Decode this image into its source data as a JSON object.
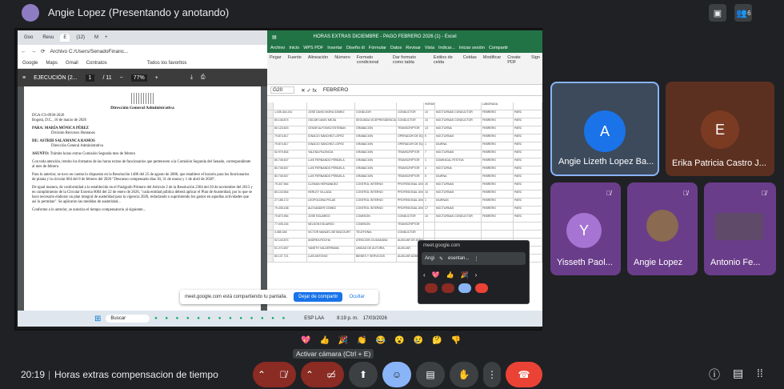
{
  "header": {
    "presenter_name": "Angie Lopez (Presentando y anotando)",
    "presenter_initial": "",
    "people_count": "6"
  },
  "browser": {
    "tabs": [
      "Goo",
      "Resu",
      "E",
      "(12)",
      "M"
    ],
    "address": "Archivo   C:/Users/SenadoFinanc...",
    "bookmarks": [
      "Google",
      "Maps",
      "Gmail",
      "Contratos",
      "Todos los favoritos"
    ],
    "pdf_title": "EJECUCIÓN (2...",
    "pdf_page": "1",
    "pdf_pages": "/ 11",
    "pdf_zoom": "77%",
    "doc": {
      "org": "Dirección General Administrativa",
      "ref": "DGA-CS-0930-2026",
      "date": "Bogotá, D.C., 16 de marzo de 2026",
      "para_label": "PARA:",
      "para_name": "MARÍA MÓNICA PÉREZ",
      "para_role": "División Recursos Humanos",
      "de_label": "DE:",
      "de_name": "ASTRID SALAMANCA RAMOS",
      "de_role": "Dirección General Administrativa",
      "asunto_label": "ASUNTO:",
      "asunto": "Trámite horas extras Comisión Segunda mes de febrero",
      "p1": "Con toda atención, remito los formatos de las horas extras de funcionarios que pertenecen a la Comisión Segunda del Senado, correspondiente al mes de febrero.",
      "p2": "Para lo anterior, se tuvo en cuenta lo dispuesto en la Resolución 1486 del 25 de agosto de 2006, que establece el horario para los funcionarios de planta y la circular 004 del 8 de febrero del 2026 \"Descanso compensado días 30, 31 de marzo y 1 de abril de 2026\".",
      "p3": "De igual manera, de conformidad a lo establecido en el Parágrafo Primero del Artículo 2 de la Resolución 2304 del 20 de noviembre del 2013 y en cumplimiento de la Circular Externa 0004 del 22 de enero de 2026, \"cada entidad pública deberá aplicar el Plan de Austeridad, por lo que se hace necesario elaborar un plan integral de austeridad para la vigencia 2026, redactando o suprimiendo los gastos en aquellas actividades que así lo permitan\". Se aplicaron las medidas de austeridad...",
      "p4": "Conforme a lo anterior, se autoriza el tiempo compensatorio al siguiente..."
    }
  },
  "excel": {
    "title": "HORAS EXTRAS DICIEMBRE - PAGO FEBRERO 2026 (1) - Excel",
    "menu": [
      "Archivo",
      "Inicio",
      "WPS PDF",
      "Insertar",
      "Diseño di",
      "Fórmular",
      "Datos",
      "Revisar",
      "Vista",
      "Indicar...",
      "Iniciar sesión",
      "Compartir"
    ],
    "ribbon": [
      "Pegar",
      "Fuente",
      "Alineación",
      "Número",
      "Formato condicional",
      "Dar formato como tabla",
      "Estilos de celda",
      "Celdas",
      "Modificar",
      "Create PDF",
      "Sign"
    ],
    "cell_ref": "G20",
    "formula": "FEBRERO",
    "header_row": [
      "",
      "",
      "",
      "",
      "HORAS",
      "",
      "LABORADA",
      ""
    ],
    "rows": [
      [
        "1.035.344.241",
        "JOSÉ DAVID MORA GÓMEZ",
        "CONDUCIR",
        "CONDUCTOR",
        "10",
        "NOCTURNAS CONDUCTOR",
        "FEBRERO",
        "PARC"
      ],
      [
        "80.146.874",
        "OSCAR DAVID MEJÍA",
        "SEGUNDA VICEPRESIDENCIA",
        "CONDUCTOR",
        "10",
        "NOCTURNAS CONDUCTOR",
        "FEBRERO",
        "PARC"
      ],
      [
        "80.123.603",
        "CESAR ALFONSO ESTEBAN",
        "GRABACION",
        "TRANSCRIPTOR",
        "13",
        "NOCTURNA",
        "FEBRERO",
        "PARC"
      ],
      [
        "79.874.817",
        "IGNACIO SÁNCHEZ LÓPEZ",
        "GRABACION",
        "OPERADOR DE EQUIPO",
        "9",
        "NOCTURNAS",
        "FEBRERO",
        "PARC"
      ],
      [
        "79.874.817",
        "IGNACIO SÁNCHEZ LÓPEZ",
        "GRABACION",
        "OPERADOR DE EQUIPO",
        "1",
        "DIURNA",
        "FEBRERO",
        "PARC"
      ],
      [
        "52.979.834",
        "YALENA PALENCIA",
        "GRABACION",
        "TRANSCRIPTOR",
        "7",
        "NOCTURNAS",
        "FEBRERO",
        "PARC"
      ],
      [
        "80.745.547",
        "LUIS FERNANDO PEÑUELA",
        "GRABACION",
        "TRANSCRIPTOR",
        "1",
        "DOMINICAL FESTIVA",
        "FEBRERO",
        "PARC"
      ],
      [
        "80.745.547",
        "LUIS FERNANDO PEÑUELA",
        "GRABACION",
        "TRANSCRIPTOR",
        "4",
        "NOCTURNA",
        "FEBRERO",
        "PARC"
      ],
      [
        "80.745.547",
        "LUIS FERNANDO PEÑUELA",
        "GRABACION",
        "TRANSCRIPTOR",
        "5",
        "DIURNA",
        "FEBRERO",
        "PARC"
      ],
      [
        "79.347.564",
        "CLEMAN HERNANDEZ",
        "CONTROL INTERNO",
        "PROFESIONAL UNIVERSITARIO",
        "20",
        "NOCTURNAS",
        "FEBRERO",
        "PARC"
      ],
      [
        "80.143.564",
        "HERLEY VILLADA",
        "CONTROL INTERNO",
        "PROFESIONAL UNIVERSITARIO",
        "10",
        "NOCTURNAS",
        "FEBRERO",
        "PARC"
      ],
      [
        "27.185.172",
        "LEOPOLDINA PELAE",
        "CONTROL INTERNO",
        "PROFESIONAL UNIVERSITARIO",
        "1",
        "DIURNAS",
        "FEBRERO",
        "PARC"
      ],
      [
        "79.435.438",
        "ALEXANDER GÓMEZ",
        "CONTROL INTERNO",
        "PROFESIONAL UNIVERSITARIO",
        "17",
        "NOCTURNAS",
        "FEBRERO",
        "PARC"
      ],
      [
        "79.873.954",
        "JOSÉ EDUARDO",
        "COMISION",
        "CONDUCTOR",
        "10",
        "NOCTURNAS CONDUCTOR",
        "FEBRERO",
        "PARC"
      ],
      [
        "77.005.154",
        "NELSON EDUARDO",
        "COMISION",
        "TRANSCRIPTOR",
        "",
        "",
        "",
        ""
      ],
      [
        "3.485.345",
        "VICTOR MANUEL BETANCOURT",
        "TELEFONIA",
        "CONDUCTOR",
        "",
        "",
        "",
        ""
      ],
      [
        "52.143.874",
        "ANDREA ROCHA",
        "ATENCION CIUDADANA",
        "AUXILIAR DE ATENCION",
        "",
        "",
        "",
        ""
      ],
      [
        "51.274.657",
        "YANETH VALDERRAMA",
        "UNIDAD DE AUTORIA",
        "AUXILIAR",
        "",
        "",
        "",
        ""
      ],
      [
        "80.137.721",
        "LUIS ANTONIO",
        "BIENES Y SERVICIOS",
        "AUXILIAR ADMIN",
        "",
        "",
        "",
        ""
      ]
    ]
  },
  "share_notice": {
    "text": "meet.google.com está compartiendo tu pantalla.",
    "share_btn": "Dejar de compartir",
    "hide_btn": "Ocultar"
  },
  "mini_meet": {
    "title": "meet.google.com",
    "name": "Angi",
    "presenting": "esentan..."
  },
  "taskbar": {
    "search": "Buscar",
    "lang": "ESP\nLAA",
    "time": "8:19 p. m.",
    "date": "17/03/2026"
  },
  "participants": [
    {
      "name": "Angie Lizeth Lopez Ba...",
      "initial": "A",
      "bg": "#3c4a5c",
      "avatar_bg": "#1a73e8"
    },
    {
      "name": "Erika Patricia Castro J...",
      "initial": "E",
      "bg": "#5c3020",
      "avatar_bg": "#7a3b22"
    },
    {
      "name": "Yisseth Paol...",
      "initial": "Y",
      "bg": "#6a3d8a",
      "avatar_bg": "#a674d2"
    },
    {
      "name": "Angie Lopez",
      "initial": "",
      "bg": "#6a3d8a",
      "avatar_bg": "#8a6a50"
    },
    {
      "name": "Antonio Fe...",
      "initial": "",
      "bg": "#6a3d8a",
      "avatar_bg": "#5f4a6a"
    }
  ],
  "reactions": [
    "💖",
    "👍",
    "🎉",
    "👏",
    "😂",
    "😮",
    "😢",
    "🤔",
    "👎"
  ],
  "tooltip": "Activar cámara (Ctrl + E)",
  "bottom": {
    "time": "20:19",
    "title": "Horas extras compensacion de tiempo"
  }
}
